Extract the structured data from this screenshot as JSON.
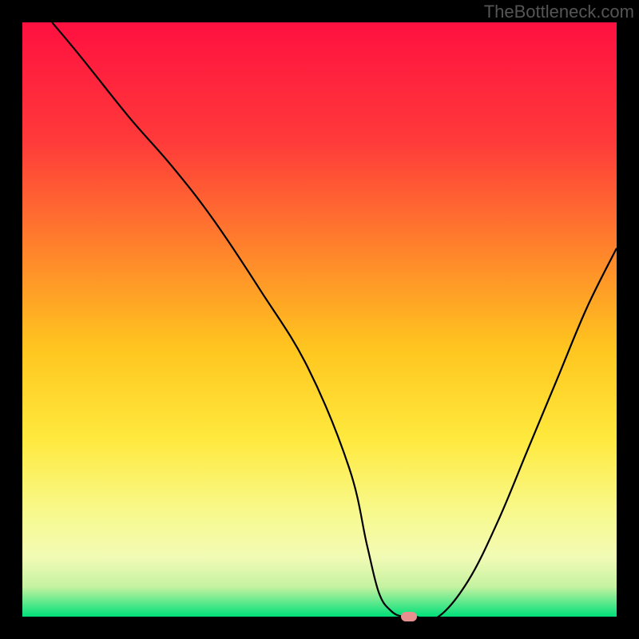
{
  "watermark": "TheBottleneck.com",
  "chart_data": {
    "type": "line",
    "title": "",
    "xlabel": "",
    "ylabel": "",
    "xlim": [
      0,
      100
    ],
    "ylim": [
      0,
      100
    ],
    "grid": false,
    "series": [
      {
        "name": "curve",
        "x": [
          5,
          10,
          18,
          25,
          32,
          40,
          48,
          55,
          58,
          60,
          62,
          64,
          66,
          70,
          75,
          80,
          85,
          90,
          95,
          100
        ],
        "values": [
          100,
          94,
          84,
          76,
          67,
          55,
          42,
          25,
          12,
          4,
          1,
          0,
          0,
          0,
          6,
          16,
          28,
          40,
          52,
          62
        ]
      }
    ],
    "marker": {
      "x": 65,
      "y": 0
    },
    "gradient_stops": [
      {
        "offset": 0,
        "color": "#ff1040"
      },
      {
        "offset": 20,
        "color": "#ff3a3a"
      },
      {
        "offset": 40,
        "color": "#ff8a2a"
      },
      {
        "offset": 55,
        "color": "#ffc61f"
      },
      {
        "offset": 70,
        "color": "#ffe93d"
      },
      {
        "offset": 82,
        "color": "#f8f98a"
      },
      {
        "offset": 90,
        "color": "#f2fbb5"
      },
      {
        "offset": 95,
        "color": "#c4f2a0"
      },
      {
        "offset": 100,
        "color": "#00e07a"
      }
    ]
  }
}
